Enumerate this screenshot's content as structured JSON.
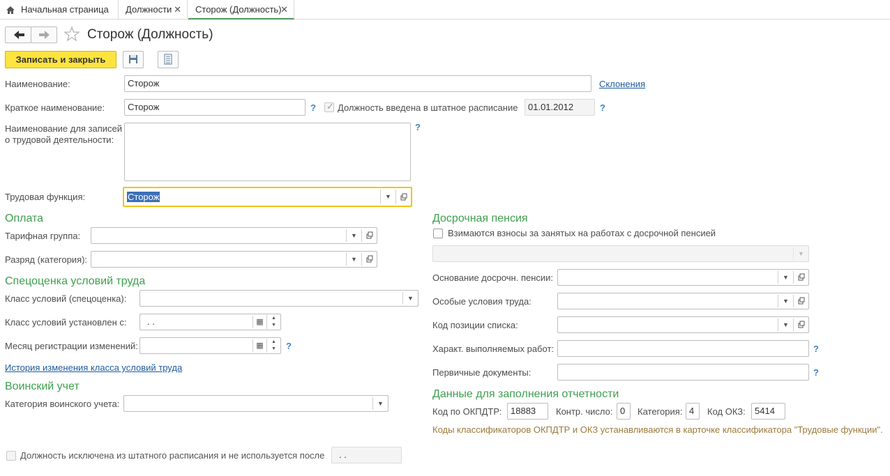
{
  "tabs": [
    {
      "label": "Начальная страница"
    },
    {
      "label": "Должности"
    },
    {
      "label": "Сторож (Должность)"
    }
  ],
  "nav": {
    "back": "🡐",
    "forward": "🡒",
    "star": "☆"
  },
  "window_title": "Сторож (Должность)",
  "toolbar": {
    "save_close_label": "Записать и закрыть"
  },
  "form": {
    "name_label": "Наименование:",
    "name_value": "Сторож",
    "declensions_link": "Склонения",
    "short_name_label": "Краткое наименование:",
    "short_name_value": "Сторож",
    "staffing_checkbox_label": "Должность введена в штатное расписание",
    "staffing_date": "01.01.2012",
    "work_records_label_1": "Наименование для записей",
    "work_records_label_2": "о трудовой деятельности:",
    "labor_function_label": "Трудовая функция:",
    "labor_function_value": "Сторож",
    "help": "?"
  },
  "payment": {
    "title": "Оплата",
    "tariff_group_label": "Тарифная группа:",
    "grade_label": "Разряд (категория):"
  },
  "special_assessment": {
    "title": "Спецоценка условий труда",
    "conditions_class_label": "Класс условий (спецоценка):",
    "class_set_from_label": "Класс условий установлен с:",
    "class_set_from_value": " .  .",
    "month_changes_label": "Месяц регистрации изменений:",
    "history_link": "История изменения класса условий труда"
  },
  "military": {
    "title": "Воинский учет",
    "category_label": "Категория воинского учета:"
  },
  "excluded": {
    "label": "Должность исключена из штатного расписания и не используется после",
    "date_value": " .  ."
  },
  "early_pension": {
    "title": "Досрочная пенсия",
    "contributions_label": "Взимаются взносы за занятых на работах с досрочной пенсией",
    "basis_label": "Основание досрочн. пенсии:",
    "special_conditions_label": "Особые условия труда:",
    "list_position_label": "Код позиции списка:",
    "work_character_label": "Характ. выполняемых работ:",
    "primary_docs_label": "Первичные документы:"
  },
  "reporting": {
    "title": "Данные для заполнения отчетности",
    "okpdtr_label": "Код по ОКПДТР:",
    "okpdtr_value": "18883",
    "check_label": "Контр. число:",
    "check_value": "0",
    "category_label": "Категория:",
    "category_value": "4",
    "okz_label": "Код ОКЗ:",
    "okz_value": "5414",
    "note": "Коды классификаторов ОКПДТР и ОКЗ устанавливаются в карточке классификатора \"Трудовые функции\"."
  }
}
